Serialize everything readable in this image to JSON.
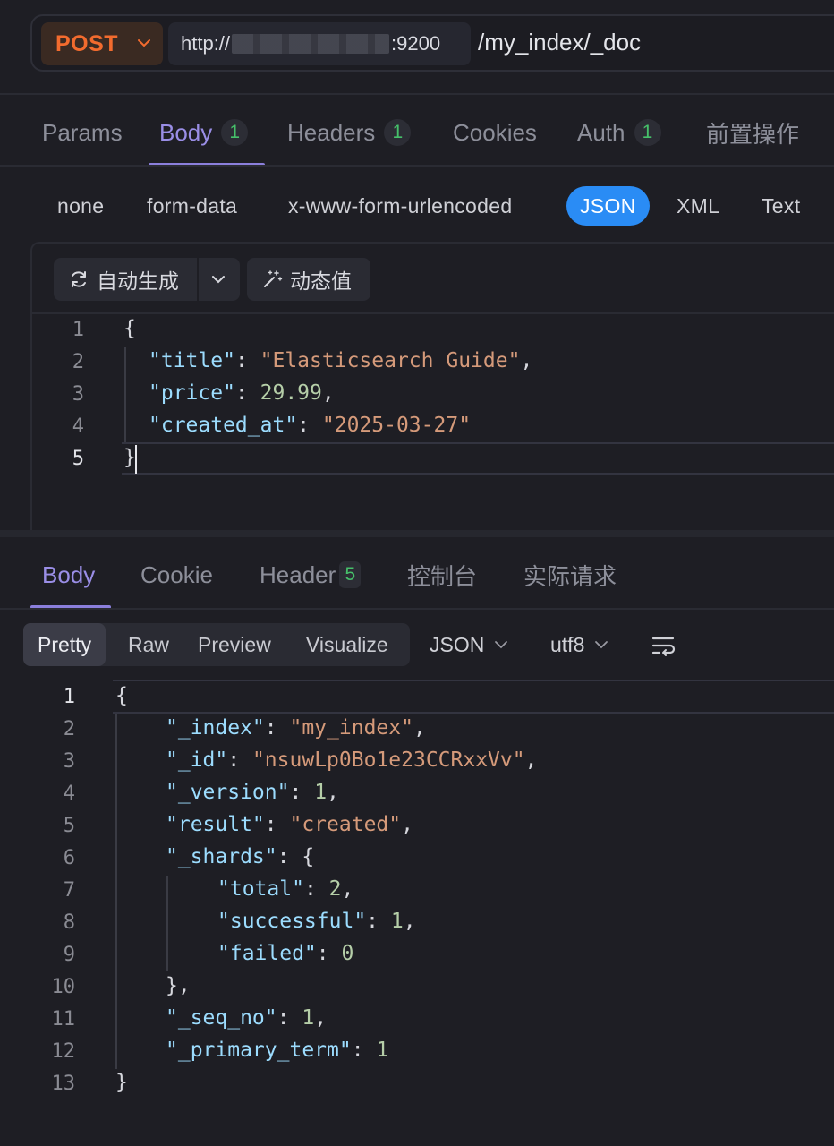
{
  "request": {
    "method": "POST",
    "url_prefix": "http://",
    "url_port": ":9200",
    "path": "/my_index/_doc"
  },
  "request_tabs": [
    {
      "label": "Params",
      "badge": ""
    },
    {
      "label": "Body",
      "badge": "1"
    },
    {
      "label": "Headers",
      "badge": "1"
    },
    {
      "label": "Cookies",
      "badge": ""
    },
    {
      "label": "Auth",
      "badge": "1"
    },
    {
      "label": "前置操作",
      "badge": ""
    }
  ],
  "body_types": [
    "none",
    "form-data",
    "x-www-form-urlencoded",
    "JSON",
    "XML",
    "Text"
  ],
  "body_type_selected": "JSON",
  "editor_tools": {
    "auto_generate": "自动生成",
    "dynamic_value": "动态值"
  },
  "request_body": {
    "line_numbers": [
      "1",
      "2",
      "3",
      "4",
      "5"
    ],
    "fields": {
      "title_key": "\"title\"",
      "title_val": "\"Elasticsearch Guide\"",
      "price_key": "\"price\"",
      "price_val": "29.99",
      "created_key": "\"created_at\"",
      "created_val": "\"2025-03-27\""
    }
  },
  "response_tabs": [
    {
      "label": "Body",
      "badge": ""
    },
    {
      "label": "Cookie",
      "badge": ""
    },
    {
      "label": "Header",
      "badge": "5"
    },
    {
      "label": "控制台",
      "badge": ""
    },
    {
      "label": "实际请求",
      "badge": ""
    }
  ],
  "response_views": [
    "Pretty",
    "Raw",
    "Preview",
    "Visualize"
  ],
  "response_view_selected": "Pretty",
  "response_format": "JSON",
  "response_encoding": "utf8",
  "response_body": {
    "line_numbers": [
      "1",
      "2",
      "3",
      "4",
      "5",
      "6",
      "7",
      "8",
      "9",
      "10",
      "11",
      "12",
      "13"
    ],
    "fields": {
      "index_key": "\"_index\"",
      "index_val": "\"my_index\"",
      "id_key": "\"_id\"",
      "id_val": "\"nsuwLp0Bo1e23CCRxxVv\"",
      "version_key": "\"_version\"",
      "version_val": "1",
      "result_key": "\"result\"",
      "result_val": "\"created\"",
      "shards_key": "\"_shards\"",
      "total_key": "\"total\"",
      "total_val": "2",
      "successful_key": "\"successful\"",
      "successful_val": "1",
      "failed_key": "\"failed\"",
      "failed_val": "0",
      "seq_key": "\"_seq_no\"",
      "seq_val": "1",
      "term_key": "\"_primary_term\"",
      "term_val": "1"
    }
  },
  "icons": [
    "chevron-down-icon",
    "refresh-icon",
    "magic-wand-icon",
    "word-wrap-icon"
  ]
}
